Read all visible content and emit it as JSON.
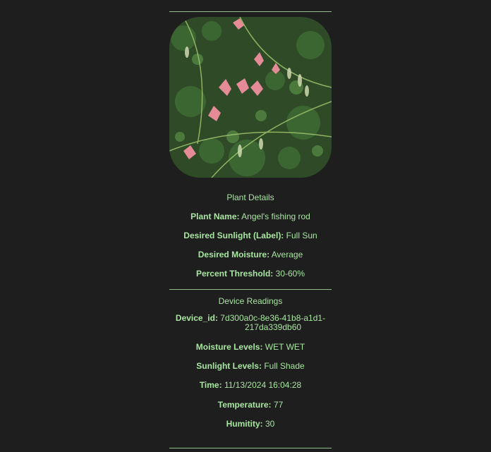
{
  "plant_details": {
    "heading": "Plant Details",
    "image_alt": "",
    "fields": [
      {
        "label": "Plant Name:",
        "value": "Angel's fishing rod"
      },
      {
        "label": "Desired Sunlight (Label):",
        "value": "Full Sun"
      },
      {
        "label": "Desired Moisture:",
        "value": "Average"
      },
      {
        "label": "Percent Threshold:",
        "value": "30-60%"
      }
    ]
  },
  "device_readings": {
    "heading": "Device Readings",
    "device_id": {
      "label": "Device_id:",
      "value_line1": "7d300a0c-8e36-41b8-a1d1-",
      "value_line2": "217da339db60"
    },
    "fields": [
      {
        "label": "Moisture Levels:",
        "value": "WET WET"
      },
      {
        "label": "Sunlight Levels:",
        "value": "Full Shade"
      },
      {
        "label": "Time:",
        "value": "11/13/2024 16:04:28"
      },
      {
        "label": "Temperature:",
        "value": "77"
      },
      {
        "label": "Humitity:",
        "value": "30"
      }
    ]
  },
  "colors": {
    "background": "#1e1e1e",
    "text": "#a8e6a1",
    "rule": "#8fbf8a"
  }
}
